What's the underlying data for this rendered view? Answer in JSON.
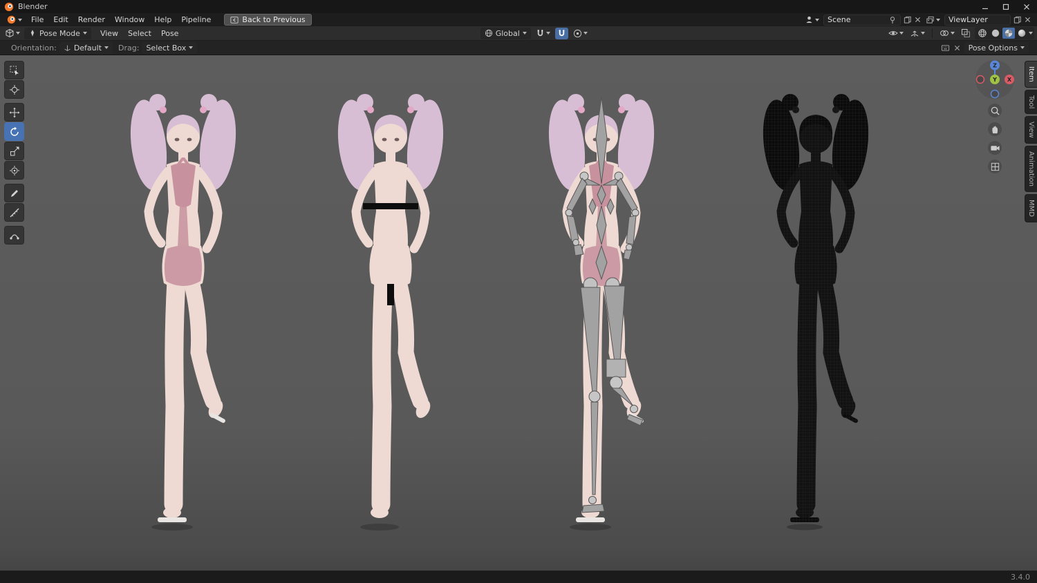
{
  "window": {
    "title": "Blender"
  },
  "menubar": {
    "items": [
      "File",
      "Edit",
      "Render",
      "Window",
      "Help",
      "Pipeline"
    ],
    "back_button": {
      "label": "Back to Previous"
    },
    "scene": {
      "label": "Scene"
    },
    "view_layer": {
      "label": "ViewLayer"
    }
  },
  "viewport_header": {
    "mode": {
      "label": "Pose Mode"
    },
    "menus": [
      "View",
      "Select",
      "Pose"
    ],
    "transform": {
      "orientation": "Global"
    },
    "right_icons": [
      "object-visibility-icon",
      "gizmos-icon",
      "overlays-icon",
      "xray-icon",
      "shading-wireframe-icon",
      "shading-solid-icon",
      "shading-material-icon",
      "shading-rendered-icon"
    ]
  },
  "tool_settings": {
    "orientation_label": "Orientation:",
    "orientation_value": "Default",
    "drag_label": "Drag:",
    "drag_value": "Select Box",
    "pose_options_label": "Pose Options"
  },
  "left_toolbar": {
    "active_tool": "rotate",
    "tools": [
      "select-box",
      "cursor",
      "move",
      "rotate",
      "scale",
      "transform",
      "annotate",
      "measure",
      "pose-breakdowner"
    ]
  },
  "sidebar_tabs": {
    "items": [
      "Item",
      "Tool",
      "View",
      "Animation",
      "MMD"
    ],
    "active": "Item"
  },
  "nav": {
    "gizmo_axes": {
      "x": "X",
      "y": "Y",
      "z": "Z"
    },
    "icons": [
      "zoom-icon",
      "pan-hand-icon",
      "camera-view-icon",
      "toggle-projection-icon"
    ]
  },
  "viewport": {
    "models": [
      {
        "name": "character-textured-swimsuit"
      },
      {
        "name": "character-textured-censored"
      },
      {
        "name": "character-armature-pose-overlay"
      },
      {
        "name": "character-wireframe"
      }
    ]
  },
  "status_bar": {
    "version": "3.4.0"
  },
  "colors": {
    "accent": "#4772b3",
    "viewport_bg": "#595959",
    "skin": "#eed9d3",
    "hair": "#d8bed4",
    "swimsuit": "#c7929e",
    "armature": "#a2a2a2",
    "axis_x": "#d95b66",
    "axis_y": "#9fc244",
    "axis_z": "#5a86d8"
  }
}
